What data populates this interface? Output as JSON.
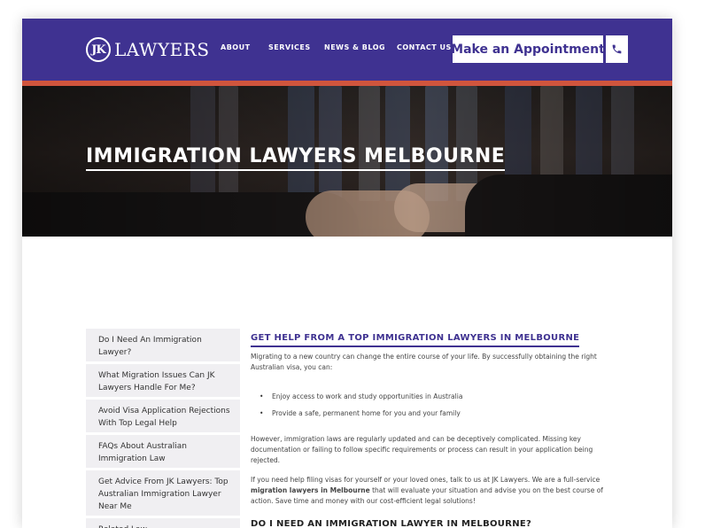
{
  "header": {
    "logo_mark": "JK",
    "logo_text": "LAWYERS",
    "nav": [
      "ABOUT",
      "SERVICES",
      "NEWS & BLOG",
      "CONTACT US"
    ],
    "appointment_label": "Make an Appointment",
    "phone_icon": "phone-icon",
    "colors": {
      "header_bg": "#3f3291",
      "accent_bar": "#d0553d"
    }
  },
  "hero": {
    "title": "IMMIGRATION LAWYERS MELBOURNE"
  },
  "sidebar": {
    "items": [
      "Do I Need An Immigration Lawyer?",
      "What Migration Issues Can JK Lawyers Handle For Me?",
      "Avoid Visa Application Rejections With Top Legal Help",
      "FAQs About Australian Immigration Law",
      "Get Advice From JK Lawyers: Top Australian Immigration Lawyer Near Me",
      "Related Law"
    ]
  },
  "content": {
    "heading": "GET HELP FROM A TOP IMMIGRATION LAWYERS IN MELBOURNE",
    "intro": "Migrating to a new country can change the entire course of your life. By successfully obtaining the right Australian visa, you can:",
    "bullets": [
      "Enjoy access to work and study opportunities in Australia",
      "Provide a safe, permanent home for you and your family"
    ],
    "para2": "However, immigration laws are regularly updated and can be deceptively complicated. Missing key documentation or failing to follow specific requirements or process can result in your application being rejected.",
    "para3_start": "If you need help filing visas for yourself or your loved ones, talk to us at JK Lawyers. We are a full-service",
    "para3_bold": "migration lawyers in Melbourne",
    "para3_end": "that will evaluate your situation and advise you on the best course of action. Save time and money with our cost-efficient legal solutions!",
    "heading2": "DO I NEED AN IMMIGRATION LAWYER IN MELBOURNE?"
  }
}
